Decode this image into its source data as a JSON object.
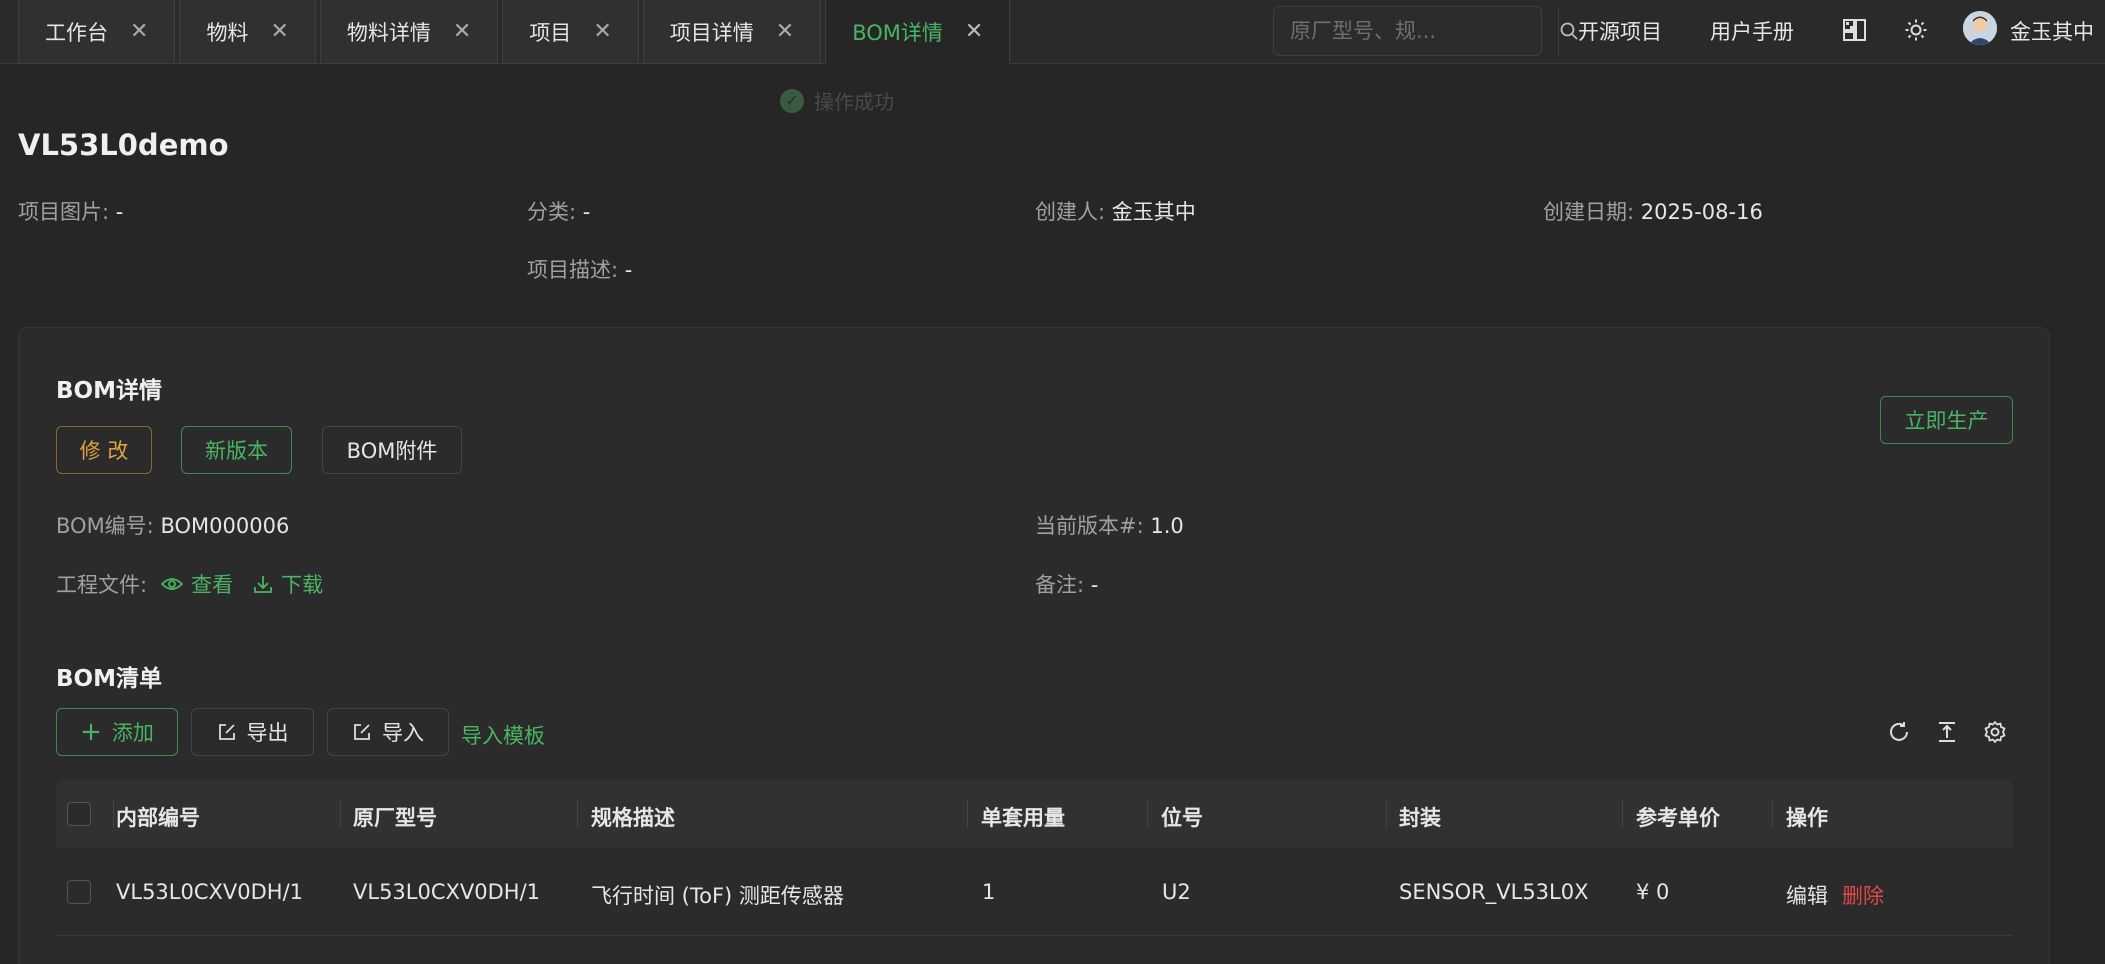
{
  "tabs": [
    {
      "label": "工作台",
      "active": false
    },
    {
      "label": "物料",
      "active": false
    },
    {
      "label": "物料详情",
      "active": false
    },
    {
      "label": "项目",
      "active": false
    },
    {
      "label": "项目详情",
      "active": false
    },
    {
      "label": "BOM详情",
      "active": true
    }
  ],
  "header": {
    "search_placeholder": "原厂型号、规...",
    "open_source": "开源项目",
    "manual": "用户手册",
    "username": "金玉其中",
    "icons": [
      "search-icon",
      "layout-icon",
      "sun-icon",
      "avatar"
    ]
  },
  "toast": "操作成功",
  "project": {
    "title": "VL53L0demo",
    "image_label": "项目图片:",
    "image_value": "-",
    "category_label": "分类:",
    "category_value": "-",
    "creator_label": "创建人:",
    "creator_value": "金玉其中",
    "date_label": "创建日期:",
    "date_value": "2025-08-16",
    "desc_label": "项目描述:",
    "desc_value": "-"
  },
  "bom": {
    "title": "BOM详情",
    "edit": "修 改",
    "new_version": "新版本",
    "attachments": "BOM附件",
    "produce": "立即生产",
    "code_label": "BOM编号:",
    "code_value": "BOM000006",
    "version_label": "当前版本#:",
    "version_value": "1.0",
    "files_label": "工程文件:",
    "view": "查看",
    "download": "下载",
    "note_label": "备注:",
    "note_value": "-"
  },
  "list": {
    "title": "BOM清单",
    "add": "添加",
    "export": "导出",
    "import": "导入",
    "template": "导入模板",
    "columns": [
      "内部编号",
      "原厂型号",
      "规格描述",
      "单套用量",
      "位号",
      "封装",
      "参考单价",
      "操作"
    ],
    "rows": [
      {
        "internal": "VL53L0CXV0DH/1",
        "mpn": "VL53L0CXV0DH/1",
        "spec": "飞行时间 (ToF) 测距传感器",
        "qty": "1",
        "ref": "U2",
        "package": "SENSOR_VL53L0X",
        "price": "¥ 0",
        "edit": "编辑",
        "delete": "删除"
      }
    ]
  },
  "colors": {
    "accent": "#49b563",
    "warn": "#e0a341",
    "danger": "#e04848"
  }
}
